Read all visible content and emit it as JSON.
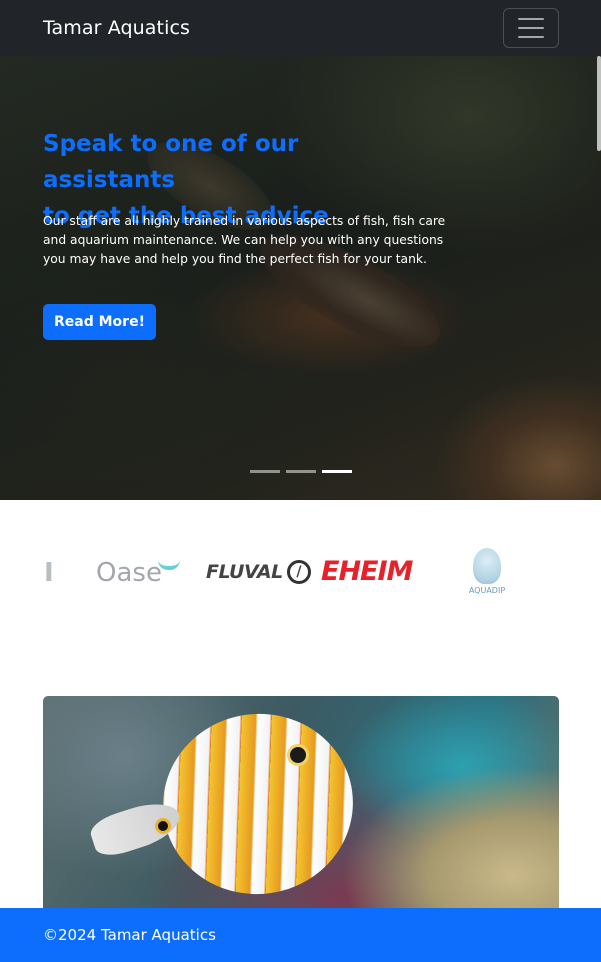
{
  "navbar": {
    "brand": "Tamar Aquatics",
    "toggler_icon": "hamburger-icon"
  },
  "hero": {
    "title_line1": "Speak to one of our assistants",
    "title_line2": "to get the best advice",
    "text": "Our staff are all highly trained in various aspects of fish, fish care and aquarium maintenance. We can help you with any questions you may have and help you find the perfect fish for your tank.",
    "button_label": "Read More!",
    "slides_count": 3,
    "active_slide": 3
  },
  "brands": {
    "logos": [
      {
        "name": "partial-logo",
        "text": "I"
      },
      {
        "name": "oase-logo",
        "text": "Oase"
      },
      {
        "name": "fluval-logo",
        "text": "FLUVAL"
      },
      {
        "name": "eheim-logo",
        "text": "EHEIM"
      },
      {
        "name": "aquadip-logo",
        "text": "AQUADIP"
      }
    ]
  },
  "footer": {
    "text": "©2024 Tamar Aquatics"
  },
  "colors": {
    "primary": "#0d6efd",
    "navbar": "#212529",
    "eheim_red": "#e8202a"
  }
}
